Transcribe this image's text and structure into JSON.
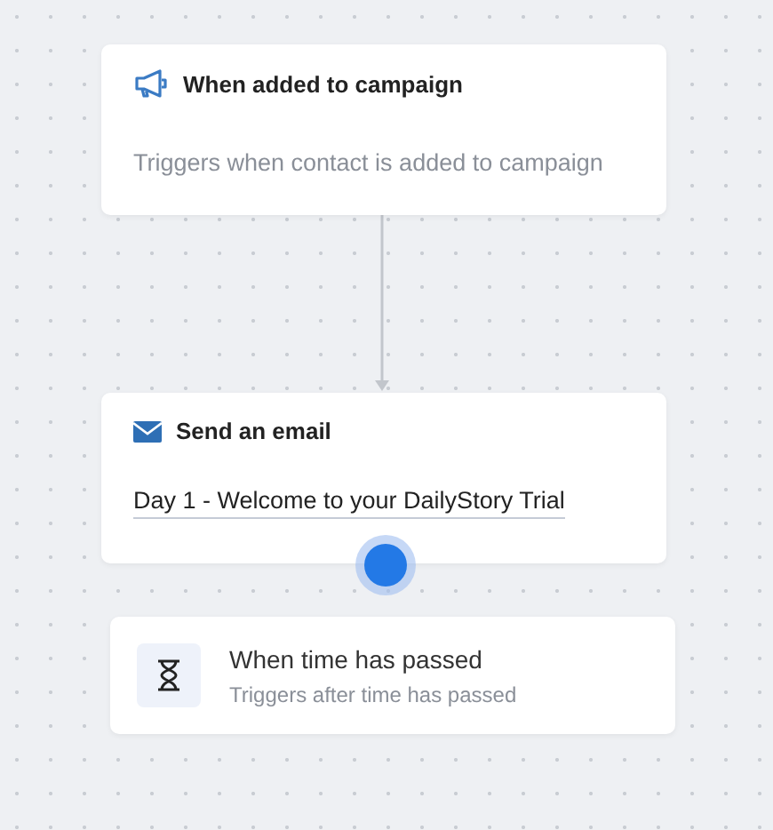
{
  "trigger_card": {
    "title": "When added to campaign",
    "description": "Triggers when contact is added to campaign"
  },
  "email_card": {
    "title": "Send an email",
    "email_link": "Day 1 - Welcome to your DailyStory Trial"
  },
  "add_step_handle": {
    "selected": true
  },
  "option_card": {
    "title": "When time has passed",
    "description": "Triggers after time has passed"
  }
}
